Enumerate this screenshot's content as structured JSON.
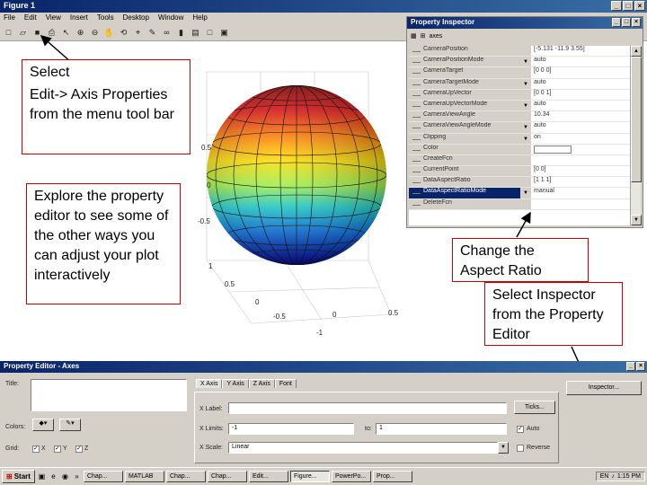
{
  "figure": {
    "title": "Figure 1",
    "menu": [
      "File",
      "Edit",
      "View",
      "Insert",
      "Tools",
      "Desktop",
      "Window",
      "Help"
    ],
    "toolbar": [
      {
        "name": "new-figure-icon",
        "glyph": "□"
      },
      {
        "name": "open-file-icon",
        "glyph": "▱"
      },
      {
        "name": "save-icon",
        "glyph": "■"
      },
      {
        "name": "print-icon",
        "glyph": "⎙"
      },
      {
        "name": "edit-plot-icon",
        "glyph": "↖"
      },
      {
        "name": "zoom-in-icon",
        "glyph": "⊕"
      },
      {
        "name": "zoom-out-icon",
        "glyph": "⊖"
      },
      {
        "name": "pan-icon",
        "glyph": "✋"
      },
      {
        "name": "rotate-3d-icon",
        "glyph": "⟲"
      },
      {
        "name": "data-cursor-icon",
        "glyph": "⌖"
      },
      {
        "name": "brush-icon",
        "glyph": "✎"
      },
      {
        "name": "link-icon",
        "glyph": "∞"
      },
      {
        "name": "colorbar-icon",
        "glyph": "▮"
      },
      {
        "name": "legend-icon",
        "glyph": "▤"
      },
      {
        "name": "hide-tools-icon",
        "glyph": "□"
      },
      {
        "name": "show-tools-icon",
        "glyph": "▣"
      }
    ]
  },
  "axes": {
    "z_ticks": [
      "0.5",
      "0",
      "-0.5"
    ],
    "y_ticks": [
      "1",
      "0.5",
      "0"
    ],
    "x_ticks": [
      "0.5",
      "0",
      "-0.5",
      "-1"
    ]
  },
  "annotations": {
    "select": "Select",
    "edit_axis": "Edit-> Axis Properties from the menu tool bar",
    "explore": "Explore the property editor to see some of the other ways you can adjust your plot interactively",
    "aspect": "Change the Aspect Ratio",
    "inspector": "Select Inspector from the Property Editor"
  },
  "inspector": {
    "title": "Property Inspector",
    "header": "axes",
    "rows": [
      {
        "name": "CameraPosition",
        "value": "[-5.131 -11.9 3.55]",
        "dd": false
      },
      {
        "name": "CameraPositionMode",
        "value": "auto",
        "dd": true
      },
      {
        "name": "CameraTarget",
        "value": "[0 0 0]",
        "dd": false
      },
      {
        "name": "CameraTargetMode",
        "value": "auto",
        "dd": true
      },
      {
        "name": "CameraUpVector",
        "value": "[0 0 1]",
        "dd": false
      },
      {
        "name": "CameraUpVectorMode",
        "value": "auto",
        "dd": true
      },
      {
        "name": "CameraViewAngle",
        "value": "10.34",
        "dd": false
      },
      {
        "name": "CameraViewAngleMode",
        "value": "auto",
        "dd": true
      },
      {
        "name": "Clipping",
        "value": "on",
        "dd": true
      },
      {
        "name": "Color",
        "value": "",
        "dd": false,
        "swatch": true
      },
      {
        "name": "CreateFcn",
        "value": "",
        "dd": false
      },
      {
        "name": "CurrentPoint",
        "value": "[0 0]",
        "dd": false
      },
      {
        "name": "DataAspectRatio",
        "value": "[1 1 1]",
        "dd": false
      },
      {
        "name": "DataAspectRatioMode",
        "value": "manual",
        "dd": true,
        "selected": true
      },
      {
        "name": "DeleteFcn",
        "value": "",
        "dd": false
      }
    ]
  },
  "editor": {
    "title": "Property Editor - Axes",
    "title_label": "Title:",
    "colors_label": "Colors:",
    "grid_label": "Grid:",
    "grid_x": "X",
    "grid_y": "Y",
    "grid_z": "Z",
    "tabs": [
      "X Axis",
      "Y Axis",
      "Z Axis",
      "Font"
    ],
    "xlabel_label": "X Label:",
    "xlimits_label": "X Limits:",
    "xlimits_from": "-1",
    "xlimits_to_label": "to:",
    "xlimits_to": "1",
    "auto_label": "Auto",
    "xscale_label": "X Scale:",
    "xscale_value": "Linear",
    "reverse_label": "Reverse",
    "ticks_button": "Ticks...",
    "inspector_button": "Inspector..."
  },
  "taskbar": {
    "start": "Start",
    "tasks": [
      "Chap...",
      "MATLAB",
      "Chap...",
      "Chap...",
      "Edit...",
      "Figure...",
      "PowerPo...",
      "Prop..."
    ],
    "active_index": 5,
    "clock": "1:15 PM"
  }
}
